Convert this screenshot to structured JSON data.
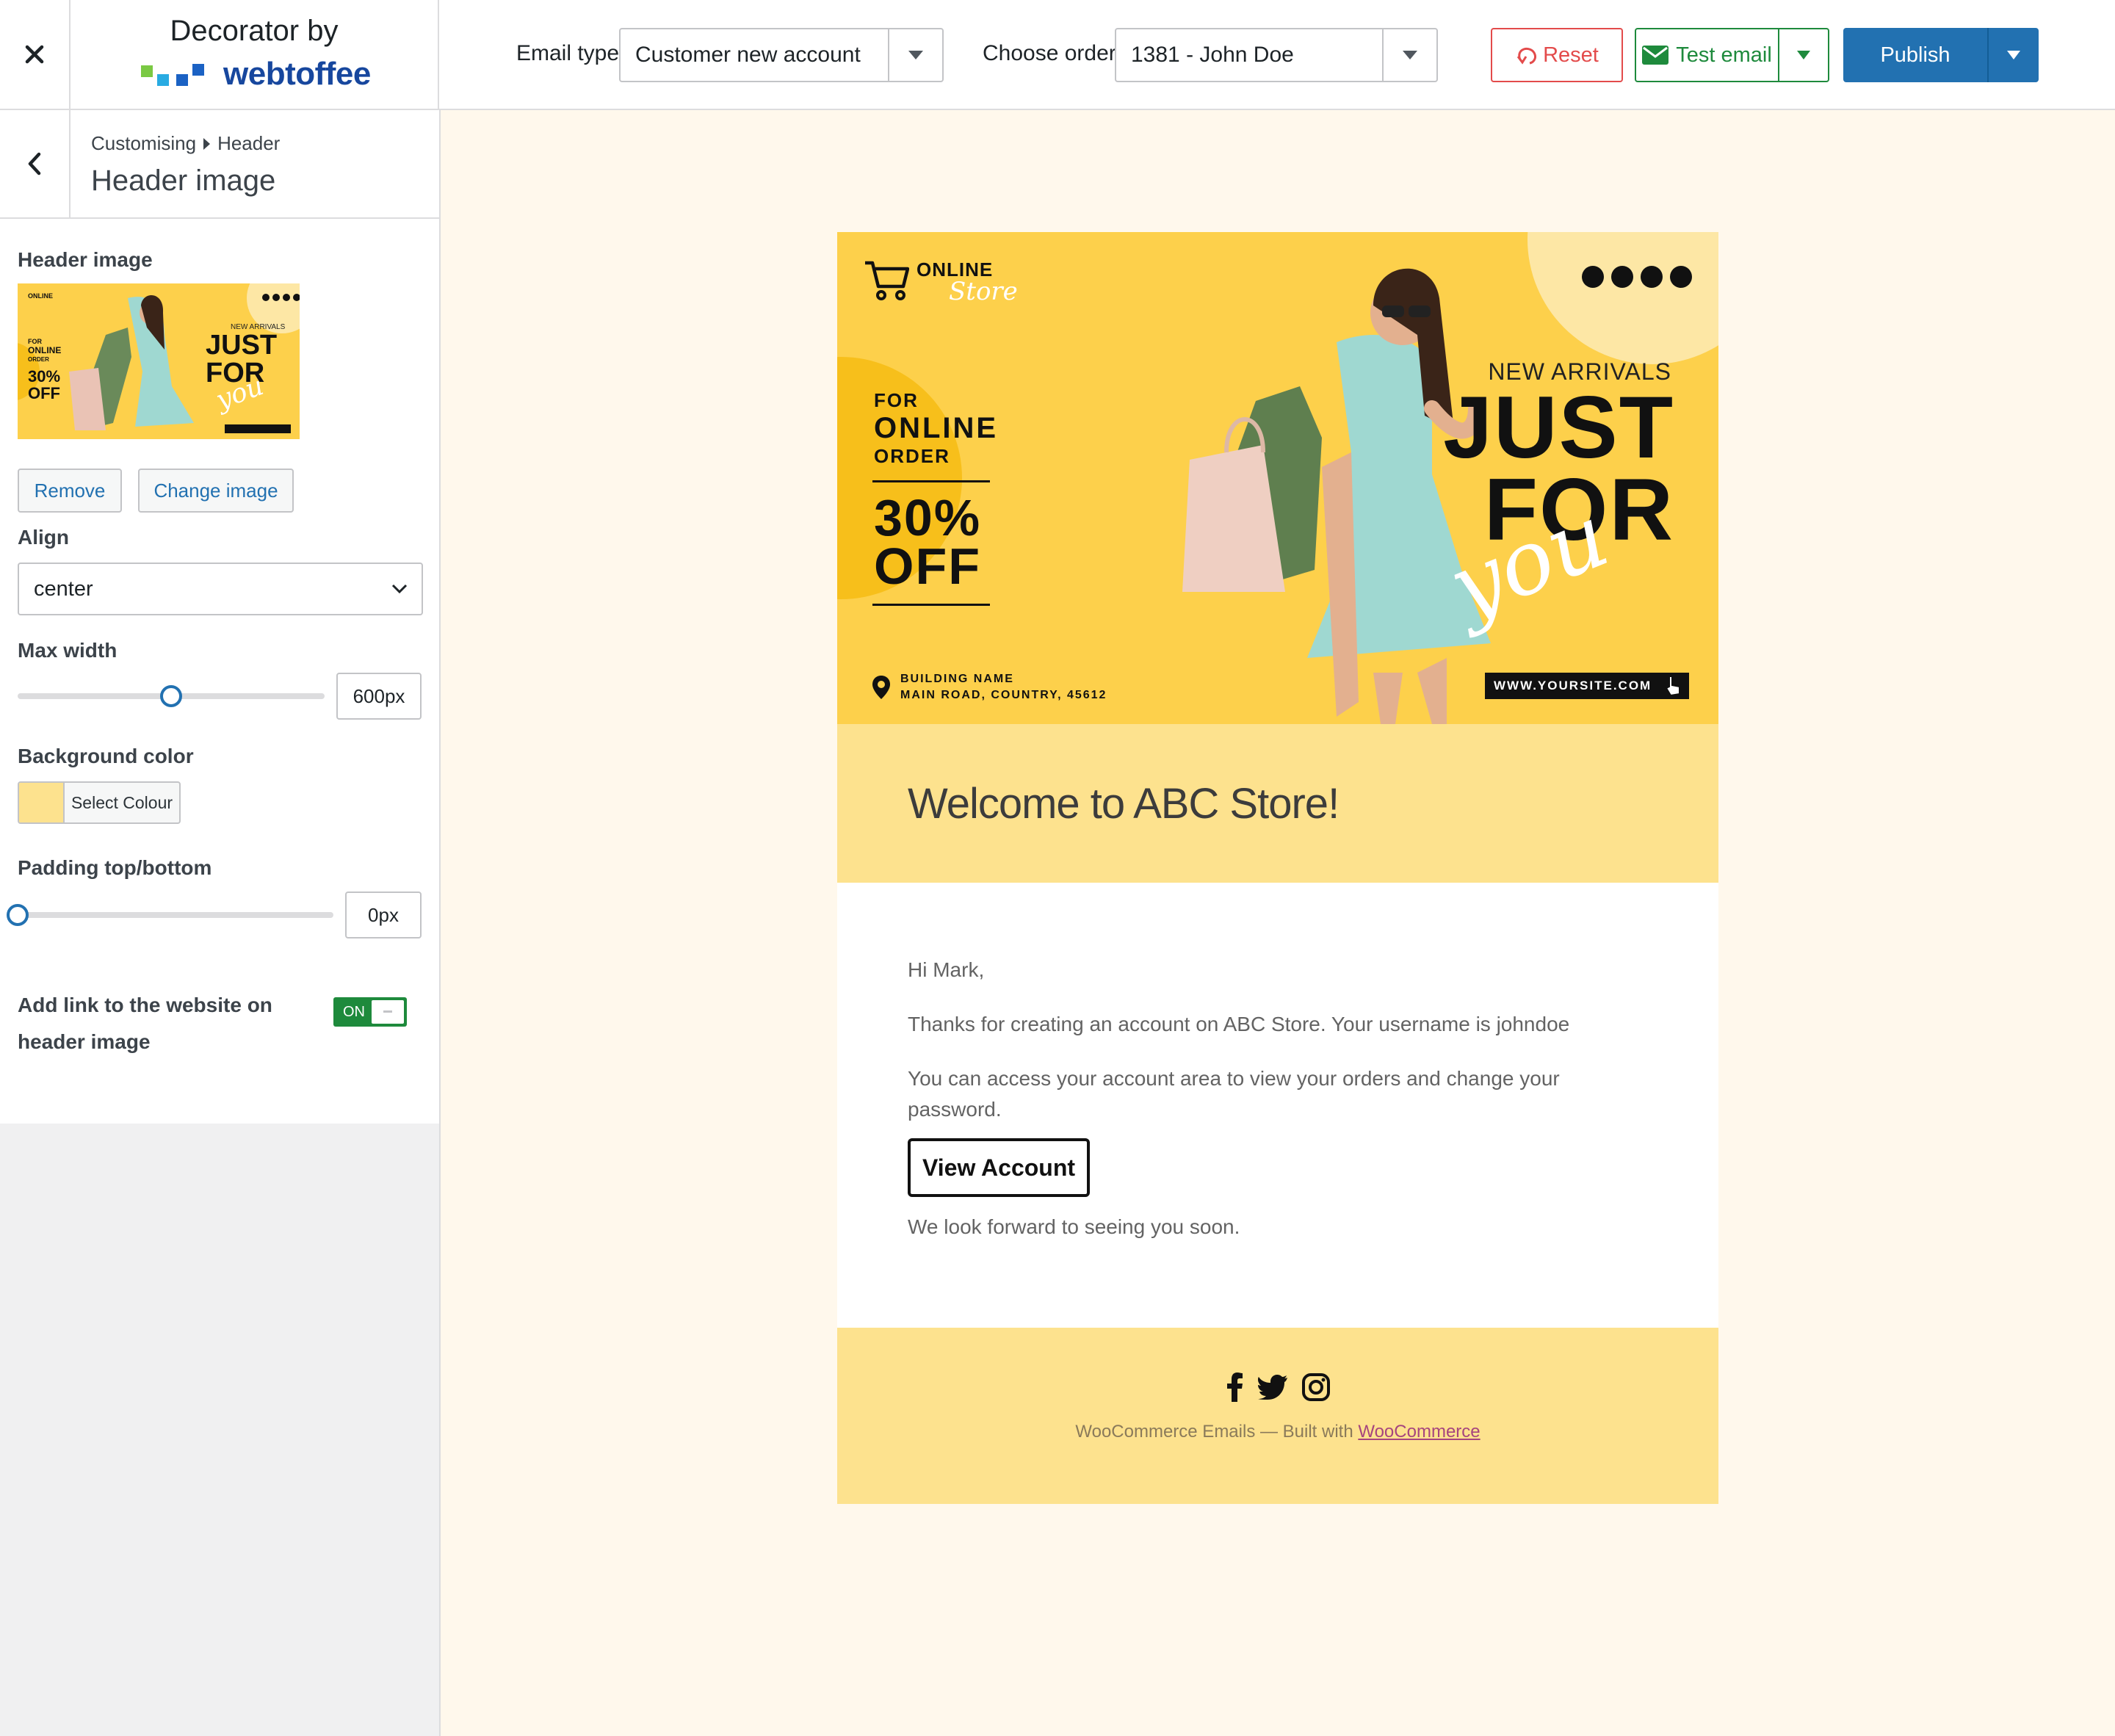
{
  "brand": {
    "line1": "Decorator by",
    "logo_word": "webtoffee"
  },
  "toolbar": {
    "email_type_label": "Email type",
    "email_type_value": "Customer new account",
    "order_label": "Choose order",
    "order_value": "1381 - John Doe",
    "reset_label": "Reset",
    "test_email_label": "Test email",
    "publish_label": "Publish"
  },
  "sidebar": {
    "breadcrumb": [
      "Customising",
      "Header"
    ],
    "title": "Header image",
    "header_image_label": "Header image",
    "remove_label": "Remove",
    "change_label": "Change image",
    "align_label": "Align",
    "align_value": "center",
    "max_width_label": "Max width",
    "max_width_value": "600px",
    "max_width_fraction": 0.5,
    "bg_color_label": "Background color",
    "bg_color_value": "#fde28e",
    "select_colour_label": "Select Colour",
    "padding_label": "Padding top/bottom",
    "padding_value": "0px",
    "padding_fraction": 0,
    "link_toggle_label": "Add link to the website on header image",
    "link_toggle_state": "ON"
  },
  "email": {
    "banner": {
      "logo_line1": "ONLINE",
      "logo_line2": "Store",
      "for": "FOR",
      "online": "ONLINE",
      "order": "ORDER",
      "percent": "30%",
      "off": "OFF",
      "address_line1": "BUILDING NAME",
      "address_line2": "MAIN ROAD, COUNTRY, 45612",
      "new_arrivals": "NEW ARRIVALS",
      "just": "JUST",
      "for_big": "FOR",
      "you": "you",
      "site": "WWW.YOURSITE.COM"
    },
    "heading": "Welcome to ABC Store!",
    "greeting": "Hi Mark,",
    "para1": "Thanks for creating an account on ABC Store. Your username is johndoe",
    "para2": "You can access your account area to view your orders and change your password.",
    "view_button": "View Account",
    "closing": "We look forward to seeing you soon.",
    "footer_prefix": "WooCommerce Emails — Built with ",
    "footer_link": "WooCommerce"
  },
  "colors": {
    "accent": "#2271b1",
    "success": "#1e8a3c",
    "danger": "#e34b4b",
    "banner_yellow": "#fdd04b",
    "email_bg": "#fde28e",
    "canvas_bg": "#fff8ec"
  },
  "icons": [
    "close-icon",
    "back-icon",
    "chevron-down-icon",
    "reset-icon",
    "mail-icon",
    "caret-down-icon",
    "cart-icon",
    "instagram-icon",
    "facebook-icon",
    "twitter-icon",
    "whatsapp-icon",
    "location-pin-icon",
    "pointer-hand-icon"
  ]
}
